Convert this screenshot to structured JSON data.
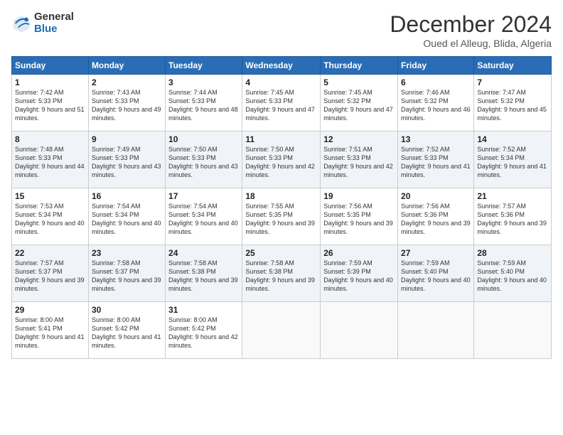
{
  "logo": {
    "general": "General",
    "blue": "Blue"
  },
  "header": {
    "month": "December 2024",
    "location": "Oued el Alleug, Blida, Algeria"
  },
  "weekdays": [
    "Sunday",
    "Monday",
    "Tuesday",
    "Wednesday",
    "Thursday",
    "Friday",
    "Saturday"
  ],
  "weeks": [
    [
      {
        "day": "1",
        "sunrise": "7:42 AM",
        "sunset": "5:33 PM",
        "daylight": "9 hours and 51 minutes."
      },
      {
        "day": "2",
        "sunrise": "7:43 AM",
        "sunset": "5:33 PM",
        "daylight": "9 hours and 49 minutes."
      },
      {
        "day": "3",
        "sunrise": "7:44 AM",
        "sunset": "5:33 PM",
        "daylight": "9 hours and 48 minutes."
      },
      {
        "day": "4",
        "sunrise": "7:45 AM",
        "sunset": "5:33 PM",
        "daylight": "9 hours and 47 minutes."
      },
      {
        "day": "5",
        "sunrise": "7:45 AM",
        "sunset": "5:32 PM",
        "daylight": "9 hours and 47 minutes."
      },
      {
        "day": "6",
        "sunrise": "7:46 AM",
        "sunset": "5:32 PM",
        "daylight": "9 hours and 46 minutes."
      },
      {
        "day": "7",
        "sunrise": "7:47 AM",
        "sunset": "5:32 PM",
        "daylight": "9 hours and 45 minutes."
      }
    ],
    [
      {
        "day": "8",
        "sunrise": "7:48 AM",
        "sunset": "5:33 PM",
        "daylight": "9 hours and 44 minutes."
      },
      {
        "day": "9",
        "sunrise": "7:49 AM",
        "sunset": "5:33 PM",
        "daylight": "9 hours and 43 minutes."
      },
      {
        "day": "10",
        "sunrise": "7:50 AM",
        "sunset": "5:33 PM",
        "daylight": "9 hours and 43 minutes."
      },
      {
        "day": "11",
        "sunrise": "7:50 AM",
        "sunset": "5:33 PM",
        "daylight": "9 hours and 42 minutes."
      },
      {
        "day": "12",
        "sunrise": "7:51 AM",
        "sunset": "5:33 PM",
        "daylight": "9 hours and 42 minutes."
      },
      {
        "day": "13",
        "sunrise": "7:52 AM",
        "sunset": "5:33 PM",
        "daylight": "9 hours and 41 minutes."
      },
      {
        "day": "14",
        "sunrise": "7:52 AM",
        "sunset": "5:34 PM",
        "daylight": "9 hours and 41 minutes."
      }
    ],
    [
      {
        "day": "15",
        "sunrise": "7:53 AM",
        "sunset": "5:34 PM",
        "daylight": "9 hours and 40 minutes."
      },
      {
        "day": "16",
        "sunrise": "7:54 AM",
        "sunset": "5:34 PM",
        "daylight": "9 hours and 40 minutes."
      },
      {
        "day": "17",
        "sunrise": "7:54 AM",
        "sunset": "5:34 PM",
        "daylight": "9 hours and 40 minutes."
      },
      {
        "day": "18",
        "sunrise": "7:55 AM",
        "sunset": "5:35 PM",
        "daylight": "9 hours and 39 minutes."
      },
      {
        "day": "19",
        "sunrise": "7:56 AM",
        "sunset": "5:35 PM",
        "daylight": "9 hours and 39 minutes."
      },
      {
        "day": "20",
        "sunrise": "7:56 AM",
        "sunset": "5:36 PM",
        "daylight": "9 hours and 39 minutes."
      },
      {
        "day": "21",
        "sunrise": "7:57 AM",
        "sunset": "5:36 PM",
        "daylight": "9 hours and 39 minutes."
      }
    ],
    [
      {
        "day": "22",
        "sunrise": "7:57 AM",
        "sunset": "5:37 PM",
        "daylight": "9 hours and 39 minutes."
      },
      {
        "day": "23",
        "sunrise": "7:58 AM",
        "sunset": "5:37 PM",
        "daylight": "9 hours and 39 minutes."
      },
      {
        "day": "24",
        "sunrise": "7:58 AM",
        "sunset": "5:38 PM",
        "daylight": "9 hours and 39 minutes."
      },
      {
        "day": "25",
        "sunrise": "7:58 AM",
        "sunset": "5:38 PM",
        "daylight": "9 hours and 39 minutes."
      },
      {
        "day": "26",
        "sunrise": "7:59 AM",
        "sunset": "5:39 PM",
        "daylight": "9 hours and 40 minutes."
      },
      {
        "day": "27",
        "sunrise": "7:59 AM",
        "sunset": "5:40 PM",
        "daylight": "9 hours and 40 minutes."
      },
      {
        "day": "28",
        "sunrise": "7:59 AM",
        "sunset": "5:40 PM",
        "daylight": "9 hours and 40 minutes."
      }
    ],
    [
      {
        "day": "29",
        "sunrise": "8:00 AM",
        "sunset": "5:41 PM",
        "daylight": "9 hours and 41 minutes."
      },
      {
        "day": "30",
        "sunrise": "8:00 AM",
        "sunset": "5:42 PM",
        "daylight": "9 hours and 41 minutes."
      },
      {
        "day": "31",
        "sunrise": "8:00 AM",
        "sunset": "5:42 PM",
        "daylight": "9 hours and 42 minutes."
      },
      null,
      null,
      null,
      null
    ]
  ]
}
